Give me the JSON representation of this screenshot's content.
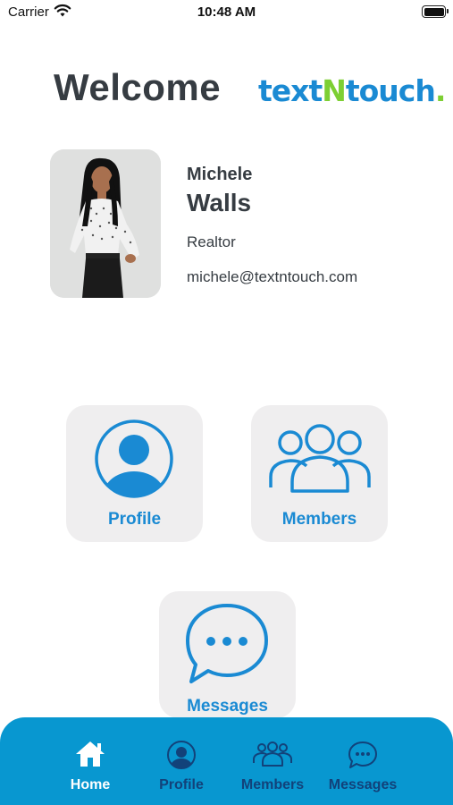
{
  "status_bar": {
    "carrier": "Carrier",
    "time": "10:48 AM"
  },
  "header": {
    "welcome": "Welcome",
    "logo": {
      "part1": "text",
      "part2": "N",
      "part3": "touch",
      "dot": "."
    }
  },
  "user": {
    "first_name": "Michele",
    "last_name": "Walls",
    "role": "Realtor",
    "email": "michele@textntouch.com"
  },
  "tiles": {
    "profile": "Profile",
    "members": "Members",
    "messages": "Messages"
  },
  "tab_bar": {
    "active": "Home",
    "items": [
      {
        "label": "Home",
        "icon": "home-icon"
      },
      {
        "label": "Profile",
        "icon": "profile-icon"
      },
      {
        "label": "Members",
        "icon": "members-icon"
      },
      {
        "label": "Messages",
        "icon": "messages-icon"
      }
    ]
  },
  "colors": {
    "brand_blue": "#1a8ad3",
    "brand_green": "#7dcf33",
    "tab_bar": "#0897d0",
    "tab_inactive": "#12427a",
    "card_bg": "#efeeef",
    "text_dark": "#363c42"
  }
}
